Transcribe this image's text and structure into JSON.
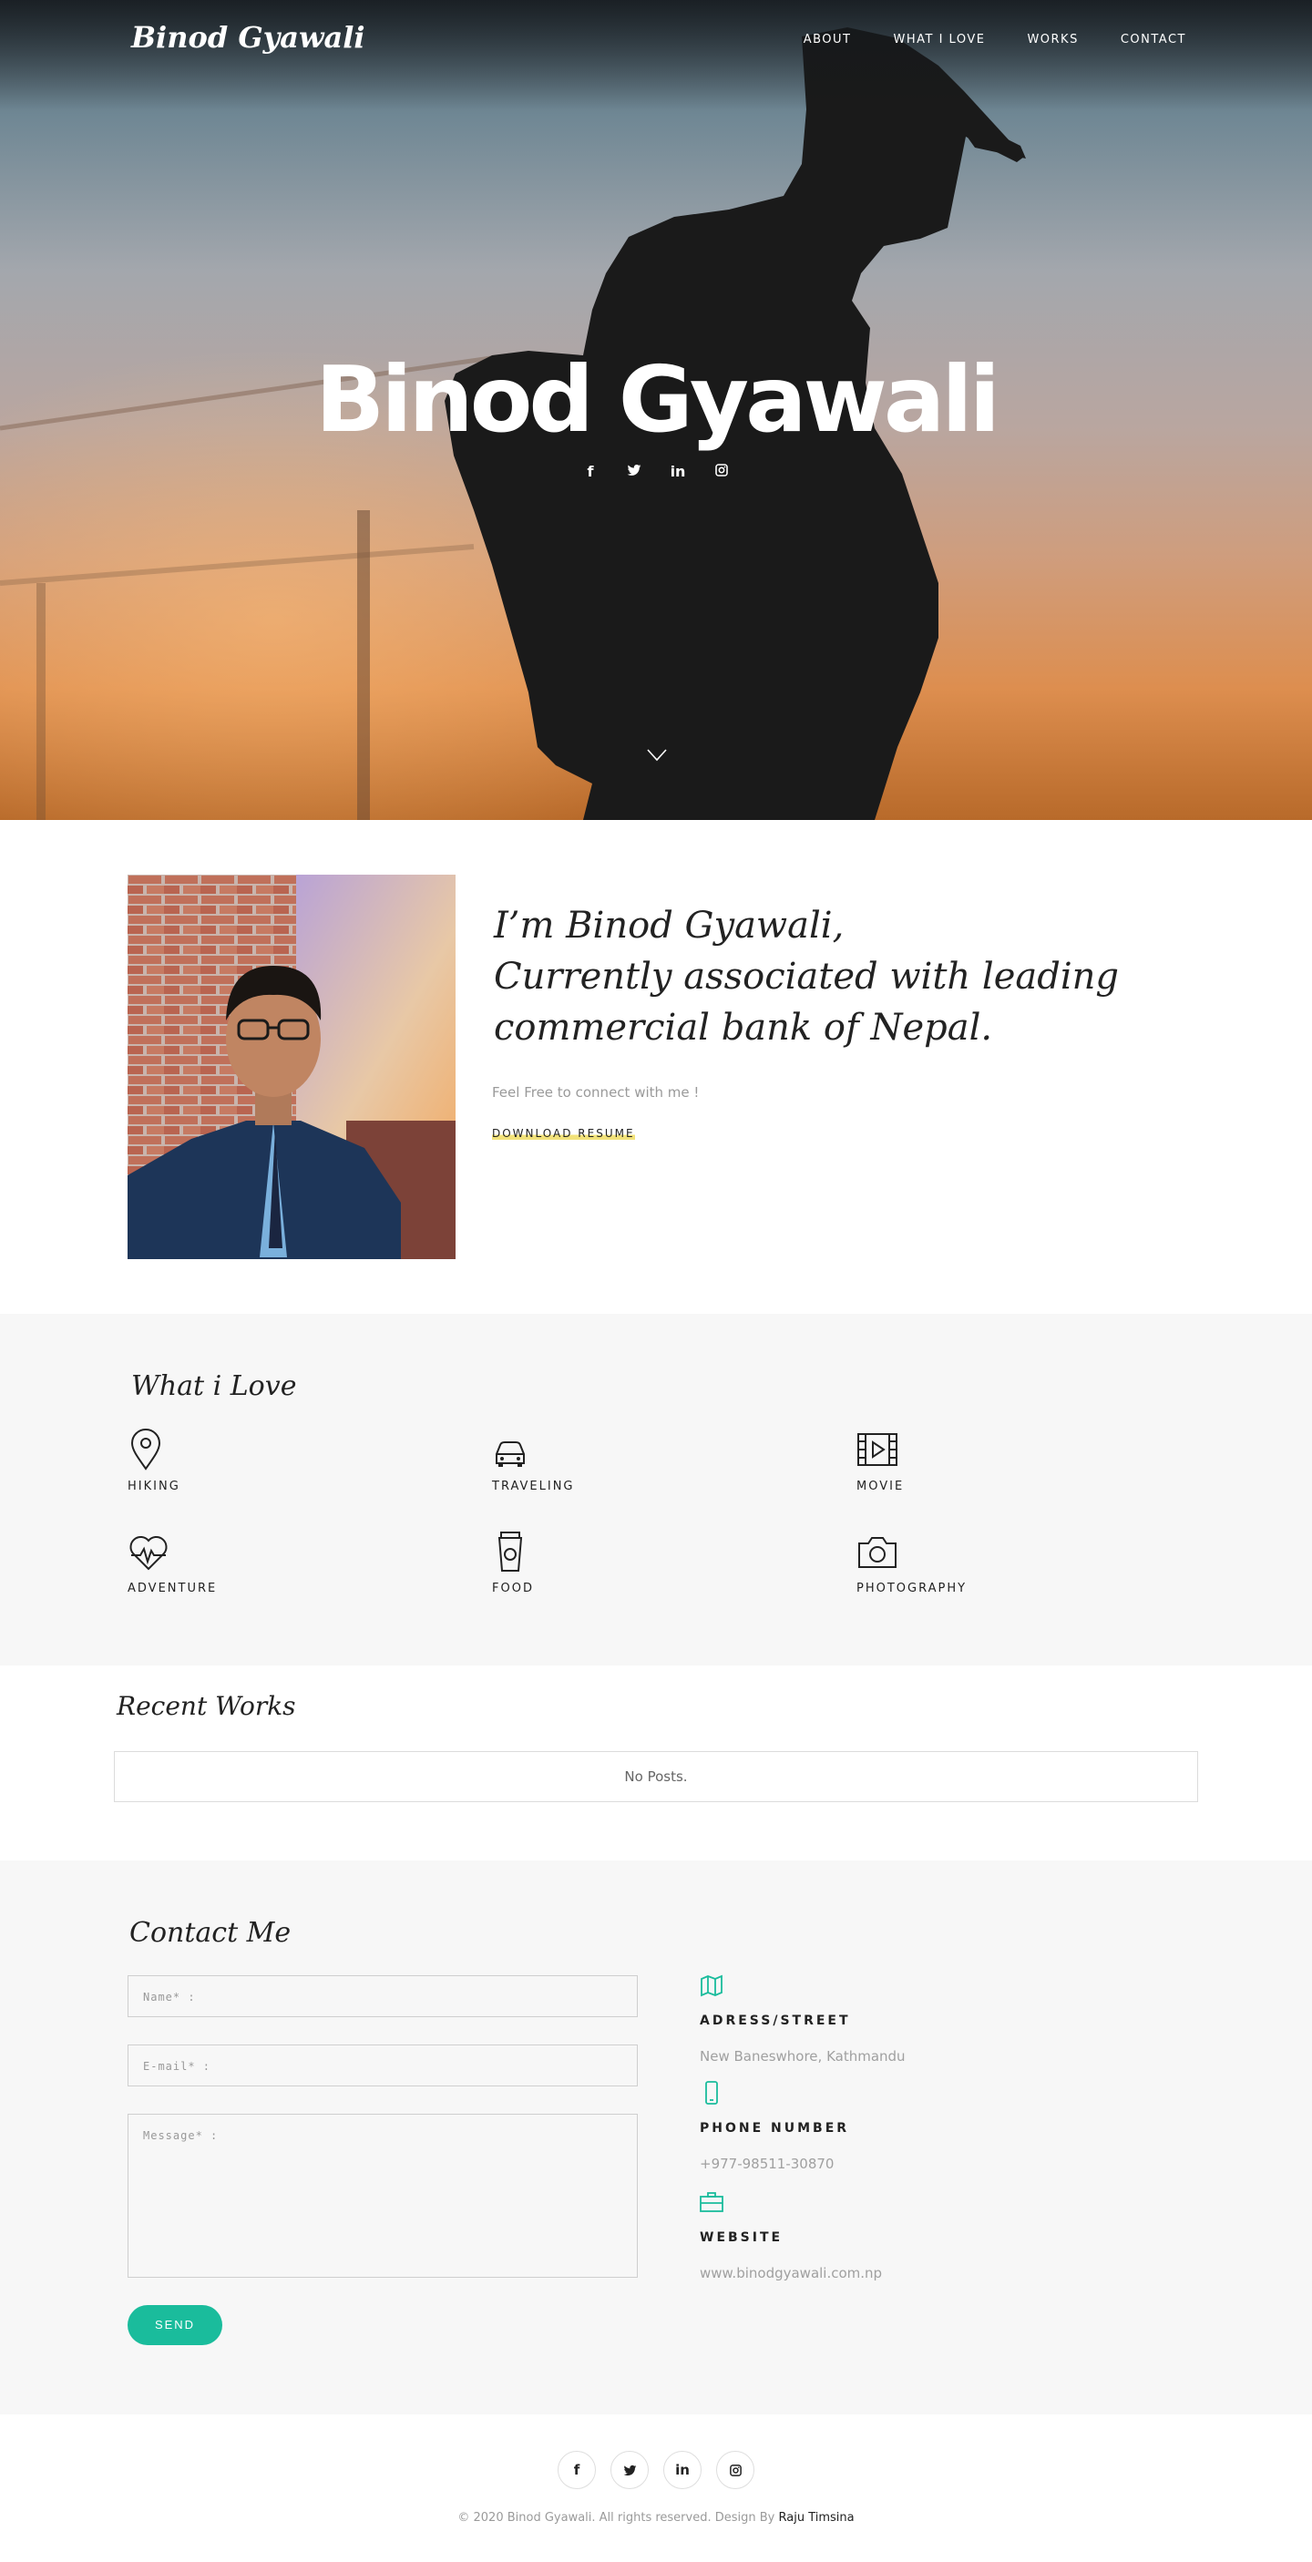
{
  "site": {
    "brand": "Binod Gyawali",
    "nav": [
      {
        "label": "ABOUT"
      },
      {
        "label": "WHAT I LOVE"
      },
      {
        "label": "WORKS"
      },
      {
        "label": "CONTACT"
      }
    ]
  },
  "hero": {
    "title": "Binod Gyawali",
    "social_icons": [
      "facebook-icon",
      "twitter-icon",
      "linkedin-icon",
      "instagram-icon"
    ],
    "scroll_icon": "chevron-down-icon"
  },
  "about": {
    "heading_line1": "I’m Binod Gyawali,",
    "heading_line2": "Currently associated with leading",
    "heading_line3": "commercial bank of Nepal.",
    "subtext": "Feel Free to connect with me !",
    "download_label": "DOWNLOAD RESUME",
    "download_highlight": "#f2e27a"
  },
  "love": {
    "title": "What i Love",
    "items": [
      {
        "label": "HIKING",
        "icon": "map-pin-icon"
      },
      {
        "label": "TRAVELING",
        "icon": "car-icon"
      },
      {
        "label": "MOVIE",
        "icon": "film-icon"
      },
      {
        "label": "ADVENTURE",
        "icon": "heartbeat-icon"
      },
      {
        "label": "FOOD",
        "icon": "coffee-cup-icon"
      },
      {
        "label": "PHOTOGRAPHY",
        "icon": "camera-icon"
      }
    ]
  },
  "works": {
    "title": "Recent Works",
    "empty_text": "No Posts."
  },
  "contact": {
    "title": "Contact Me",
    "name_placeholder": "Name* :",
    "email_placeholder": "E-mail* :",
    "message_placeholder": "Message* :",
    "send_label": "SEND",
    "accent": "#1abc9c",
    "info": [
      {
        "heading": "ADRESS/STREET",
        "value": "New Baneswhore, Kathmandu",
        "icon": "map-icon"
      },
      {
        "heading": "PHONE NUMBER",
        "value": "+977-98511-30870",
        "icon": "phone-icon"
      },
      {
        "heading": "WEBSITE",
        "value": "www.binodgyawali.com.np",
        "icon": "briefcase-icon"
      }
    ]
  },
  "footer": {
    "social_icons": [
      "facebook-icon",
      "twitter-icon",
      "linkedin-icon",
      "instagram-icon"
    ],
    "copyright": "© 2020 Binod Gyawali. All rights reserved. Design By ",
    "designer": "Raju Timsina"
  }
}
